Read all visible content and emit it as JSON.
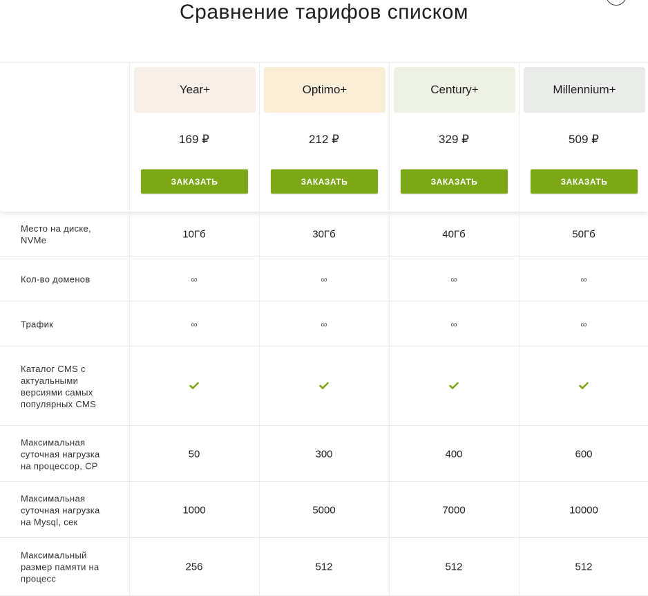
{
  "title": "Сравнение тарифов списком",
  "plans": [
    {
      "name": "Year+",
      "price": "169 ₽",
      "order_label": "ЗАКАЗАТЬ",
      "card_color": "#f8efe8"
    },
    {
      "name": "Optimo+",
      "price": "212 ₽",
      "order_label": "ЗАКАЗАТЬ",
      "card_color": "#fbeed8"
    },
    {
      "name": "Century+",
      "price": "329 ₽",
      "order_label": "ЗАКАЗАТЬ",
      "card_color": "#eef2e4"
    },
    {
      "name": "Millennium+",
      "price": "509 ₽",
      "order_label": "ЗАКАЗАТЬ",
      "card_color": "#e9ece9"
    }
  ],
  "features": [
    {
      "label": "Место на диске, NVMe",
      "values": [
        "10Гб",
        "30Гб",
        "40Гб",
        "50Гб"
      ]
    },
    {
      "label": "Кол-во доменов",
      "values": [
        "∞",
        "∞",
        "∞",
        "∞"
      ]
    },
    {
      "label": "Трафик",
      "values": [
        "∞",
        "∞",
        "∞",
        "∞"
      ]
    },
    {
      "label": "Каталог CMS с актуальными версиями самых популярных CMS",
      "values": [
        "check",
        "check",
        "check",
        "check"
      ]
    },
    {
      "label": "Максимальная суточная нагрузка на процессор, CP",
      "values": [
        "50",
        "300",
        "400",
        "600"
      ]
    },
    {
      "label": "Максимальная суточная нагрузка на Mysql, сек",
      "values": [
        "1000",
        "5000",
        "7000",
        "10000"
      ]
    },
    {
      "label": "Максимальный размер памяти на процесс",
      "values": [
        "256",
        "512",
        "512",
        "512"
      ]
    }
  ],
  "colors": {
    "accent": "#7ca817",
    "check": "#7ca817",
    "divider": "#ececec"
  },
  "icons": {
    "close": "close-icon",
    "check": "check-icon"
  }
}
